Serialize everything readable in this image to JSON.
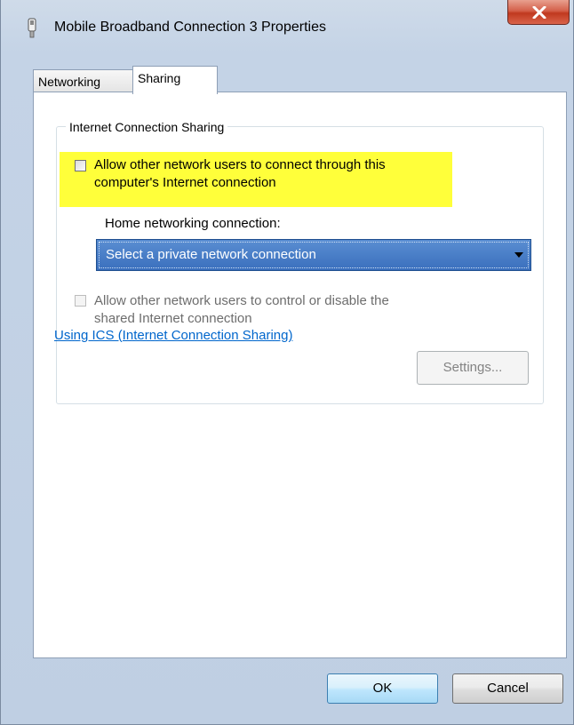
{
  "window": {
    "title": "Mobile Broadband Connection 3 Properties",
    "close_icon": "close-icon"
  },
  "tabs": [
    {
      "label": "Networking",
      "active": false
    },
    {
      "label": "Sharing",
      "active": true
    }
  ],
  "ics": {
    "group_label": "Internet Connection Sharing",
    "allow_connect_label_line1": "Allow other network users to connect through this",
    "allow_connect_label_line2": "computer's Internet connection",
    "allow_connect_checked": false,
    "highlight_color": "#ffff3a",
    "home_connection_label": "Home networking connection:",
    "home_connection_selected": "Select a private network connection",
    "allow_control_label_line1": "Allow other network users to control or disable the",
    "allow_control_label_line2": "shared Internet connection",
    "allow_control_checked": false,
    "allow_control_enabled": false,
    "help_link": "Using ICS (Internet Connection Sharing)",
    "settings_button": "Settings...",
    "settings_enabled": false
  },
  "footer": {
    "ok_label": "OK",
    "cancel_label": "Cancel"
  }
}
